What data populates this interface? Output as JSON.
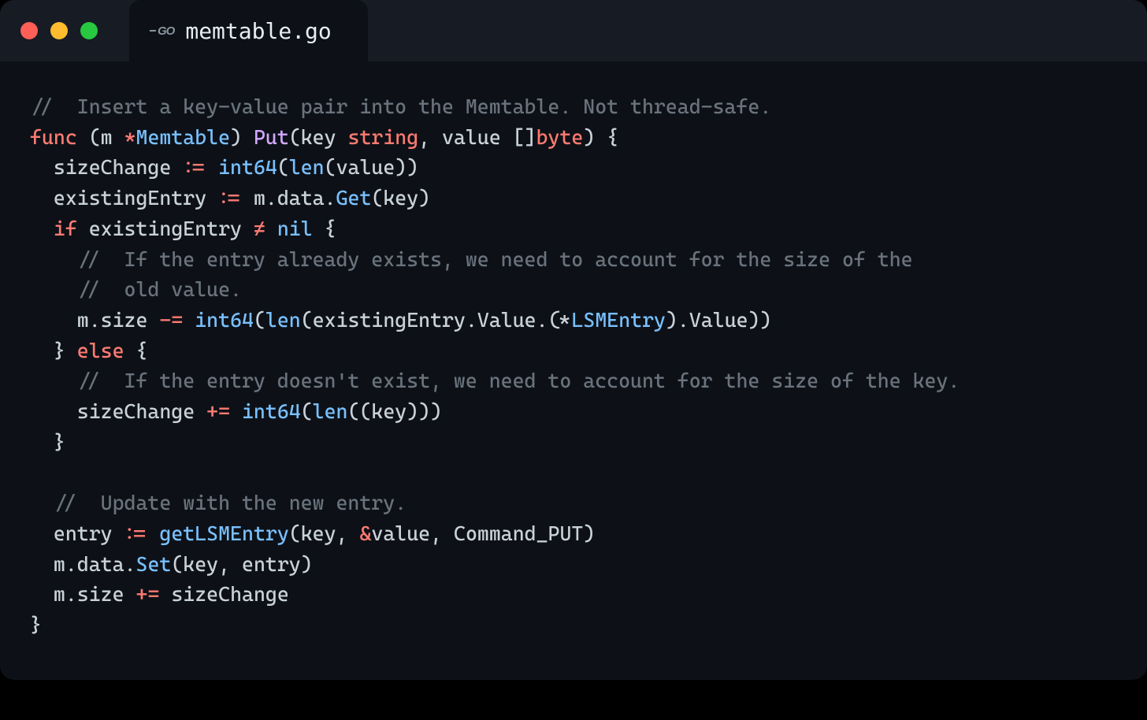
{
  "tab": {
    "filename": "memtable.go",
    "language": "Go"
  },
  "colors": {
    "traffic_red": "#ff5f57",
    "traffic_yellow": "#febc2e",
    "traffic_green": "#28c840",
    "bg_window": "#0d1117",
    "bg_titlebar": "#171c24",
    "comment": "#6a737d",
    "keyword": "#ff7b72",
    "function": "#d2a8ff",
    "type": "#79c0ff",
    "text": "#c9d1d9"
  },
  "code": {
    "l1": "//  Insert a key-value pair into the Memtable. Not thread-safe.",
    "l2_func": "func",
    "l2_recv_m": "m",
    "l2_recv_type": "Memtable",
    "l2_name": "Put",
    "l2_p1": "key",
    "l2_p1t": "string",
    "l2_p2": "value",
    "l2_p2t": "byte",
    "l3_var": "sizeChange",
    "l3_int64": "int64",
    "l3_len": "len",
    "l3_arg": "value",
    "l4_var": "existingEntry",
    "l4_m": "m",
    "l4_data": "data",
    "l4_get": "Get",
    "l4_arg": "key",
    "l5_if": "if",
    "l5_var": "existingEntry",
    "l5_nil": "nil",
    "l6": "    //  If the entry already exists, we need to account for the size of the",
    "l7": "    //  old value.",
    "l8_m": "m",
    "l8_size": "size",
    "l8_int64": "int64",
    "l8_len": "len",
    "l8_ee": "existingEntry",
    "l8_val1": "Value",
    "l8_lsm": "LSMEntry",
    "l8_val2": "Value",
    "l9_else": "else",
    "l10": "    //  If the entry doesn't exist, we need to account for the size of the key.",
    "l11_var": "sizeChange",
    "l11_int64": "int64",
    "l11_len": "len",
    "l11_key": "key",
    "l13": "  //  Update with the new entry.",
    "l14_var": "entry",
    "l14_fn": "getLSMEntry",
    "l14_key": "key",
    "l14_value": "value",
    "l14_cmd": "Command_PUT",
    "l15_m": "m",
    "l15_data": "data",
    "l15_set": "Set",
    "l15_key": "key",
    "l15_entry": "entry",
    "l16_m": "m",
    "l16_size": "size",
    "l16_sc": "sizeChange"
  }
}
